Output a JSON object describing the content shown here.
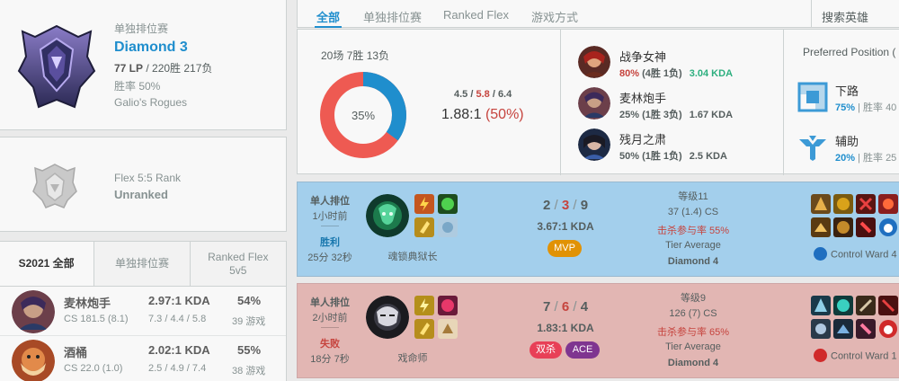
{
  "solo_rank": {
    "type": "单独排位赛",
    "tier": "Diamond 3",
    "lp": "77 LP",
    "record": "/ 220胜 217负",
    "winrate": "胜率 50%",
    "team": "Galio's Rogues"
  },
  "flex_rank": {
    "type": "Flex 5:5 Rank",
    "status": "Unranked"
  },
  "season": {
    "tabs": [
      "S2021 全部",
      "单独排位赛",
      "Ranked Flex 5v5"
    ],
    "champions": [
      {
        "name": "麦林炮手",
        "kda": "2.97:1 KDA",
        "winrate": "54%",
        "cs": "CS 181.5 (8.1)",
        "avg": "7.3 / 4.4 / 5.8",
        "games": "39 游戏"
      },
      {
        "name": "酒桶",
        "kda": "2.02:1 KDA",
        "winrate": "55%",
        "cs": "CS 22.0 (1.0)",
        "avg": "2.5 / 4.9 / 7.4",
        "games": "38 游戏"
      }
    ]
  },
  "tabs": {
    "items": [
      "全部",
      "单独排位赛",
      "Ranked Flex",
      "游戏方式"
    ],
    "search": "搜索英雄"
  },
  "summary": {
    "count": "20场 7胜 13负",
    "winrate_pct": 35,
    "winrate_label": "35%",
    "kda_k": "4.5",
    "kda_d": "5.8",
    "kda_a": "6.4",
    "ratio": "1.88:1",
    "kp": "(50%)",
    "colors": {
      "win": "#1f8ecd",
      "loss": "#ee5a52"
    },
    "top_champions": [
      {
        "name": "战争女神",
        "wr": "80%",
        "record": "(4胜 1负)",
        "kda": "3.04 KDA",
        "wr_red": true,
        "kda_green": true
      },
      {
        "name": "麦林炮手",
        "wr": "25%",
        "record": "(1胜 3负)",
        "kda": "1.67 KDA",
        "wr_red": false,
        "kda_green": false
      },
      {
        "name": "残月之肃",
        "wr": "50%",
        "record": "(1胜 1负)",
        "kda": "2.5 KDA",
        "wr_red": false,
        "kda_green": false
      }
    ],
    "preferred_title": "Preferred Position (",
    "positions": [
      {
        "name": "下路",
        "pct": "75%",
        "rate": "| 胜率 40",
        "icon": "bottom-lane-icon"
      },
      {
        "name": "辅助",
        "pct": "20%",
        "rate": "| 胜率 25",
        "icon": "support-icon"
      }
    ]
  },
  "matches": [
    {
      "type": "单人排位",
      "time": "1小时前",
      "result": "胜利",
      "length": "25分 32秒",
      "champion": "魂锁典狱长",
      "k": "2",
      "d": "3",
      "a": "9",
      "ratio": "3.67:1 KDA",
      "badges": [
        "MVP"
      ],
      "level": "等级11",
      "cs": "37 (1.4) CS",
      "kp": "击杀参与率 55%",
      "tier_label": "Tier Average",
      "tier": "Diamond 4",
      "ward": "Control Ward 4"
    },
    {
      "type": "单人排位",
      "time": "2小时前",
      "result": "失败",
      "length": "18分 7秒",
      "champion": "戏命师",
      "k": "7",
      "d": "6",
      "a": "4",
      "ratio": "1.83:1 KDA",
      "badges": [
        "双杀",
        "ACE"
      ],
      "level": "等级9",
      "cs": "126 (7) CS",
      "kp": "击杀参与率 65%",
      "tier_label": "Tier Average",
      "tier": "Diamond 4",
      "ward": "Control Ward 1"
    }
  ]
}
